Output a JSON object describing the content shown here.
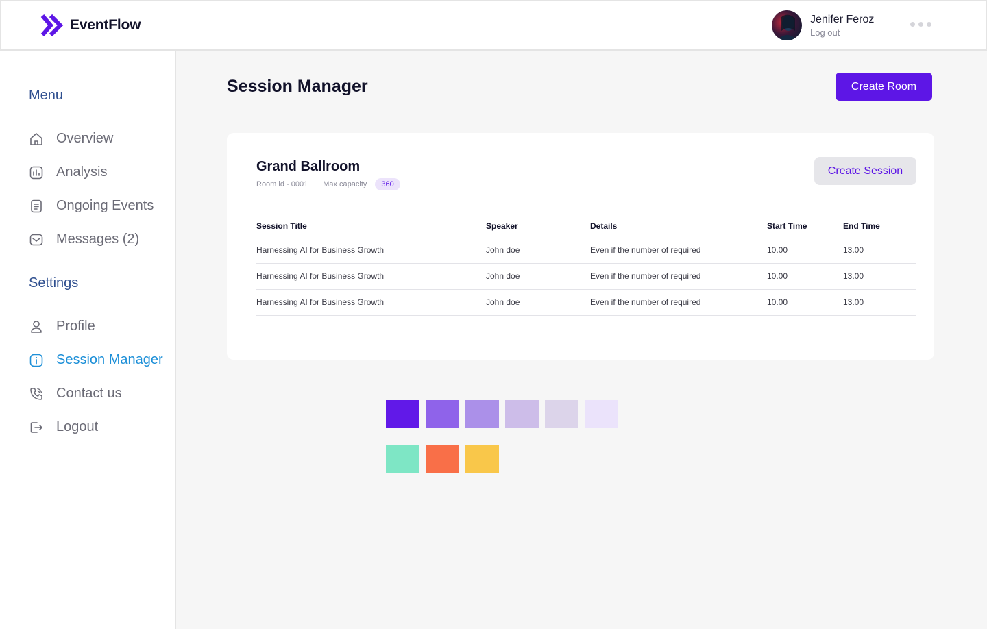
{
  "brand": {
    "name": "EventFlow",
    "logo_icon": "double-chevron-icon",
    "accent": "#5d16e6"
  },
  "user": {
    "name": "Jenifer Feroz",
    "logout_label": "Log out"
  },
  "sidebar": {
    "menu_title": "Menu",
    "menu_items": [
      {
        "label": "Overview",
        "icon": "home-icon"
      },
      {
        "label": "Analysis",
        "icon": "chart-icon"
      },
      {
        "label": "Ongoing Events",
        "icon": "document-icon"
      },
      {
        "label": "Messages (2)",
        "icon": "mail-icon"
      }
    ],
    "settings_title": "Settings",
    "settings_items": [
      {
        "label": "Profile",
        "icon": "user-icon"
      },
      {
        "label": "Session Manager",
        "icon": "info-icon",
        "active": true
      },
      {
        "label": "Contact us",
        "icon": "phone-icon"
      },
      {
        "label": "Logout",
        "icon": "logout-icon"
      }
    ]
  },
  "main": {
    "title": "Session Manager",
    "create_room_label": "Create Room",
    "room": {
      "name": "Grand Ballroom",
      "room_id": "Room id - 0001",
      "capacity_label": "Max capacity",
      "capacity": "360",
      "create_session_label": "Create Session"
    },
    "table": {
      "headers": [
        "Session Title",
        "Speaker",
        "Details",
        "Start Time",
        "End Time"
      ],
      "rows": [
        [
          "Harnessing AI for Business Growth",
          "John doe",
          "Even if the number of required",
          "10.00",
          "13.00"
        ],
        [
          "Harnessing AI for Business Growth",
          "John doe",
          "Even if the number of required",
          "10.00",
          "13.00"
        ],
        [
          "Harnessing AI for Business Growth",
          "John doe",
          "Even if the number of required",
          "10.00",
          "13.00"
        ]
      ]
    }
  },
  "palette": {
    "row1": [
      "#6119e8",
      "#8f63ea",
      "#ab90e9",
      "#cdbde9",
      "#dcd4ea",
      "#ebe3fb"
    ],
    "row2": [
      "#7ee6c5",
      "#f96f48",
      "#f9c74a"
    ]
  }
}
